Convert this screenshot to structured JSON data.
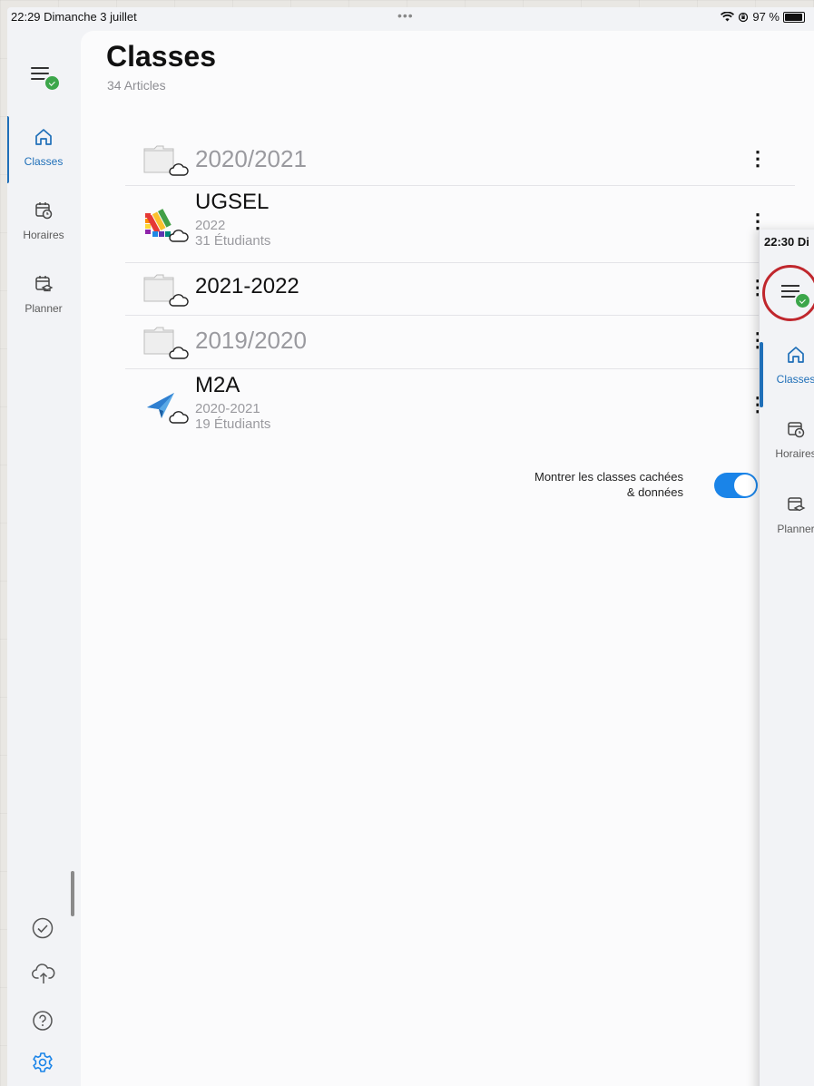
{
  "status": {
    "time_date": "22:29 Dimanche 3 juillet",
    "multitask_dots": "•••",
    "battery": "97 %"
  },
  "sidebar": {
    "items": [
      {
        "label": "Classes",
        "icon": "home-icon",
        "active": true
      },
      {
        "label": "Horaires",
        "icon": "calendar-clock-icon",
        "active": false
      },
      {
        "label": "Planner",
        "icon": "calendar-cap-icon",
        "active": false
      }
    ],
    "bottom_icons": [
      "check-circle-icon",
      "cloud-upload-icon",
      "help-icon",
      "settings-icon"
    ]
  },
  "header": {
    "title": "Classes",
    "subtitle": "34 Articles"
  },
  "list": [
    {
      "type": "folder",
      "title": "2020/2021",
      "muted": true
    },
    {
      "type": "class",
      "title": "UGSEL",
      "year": "2022",
      "students": "31 Étudiants",
      "icon": "color-swatches-icon"
    },
    {
      "type": "folder",
      "title": "2021-2022",
      "muted": false
    },
    {
      "type": "folder",
      "title": "2019/2020",
      "muted": true
    },
    {
      "type": "class",
      "title": "M2A",
      "year": "2020-2021",
      "students": "19 Étudiants",
      "icon": "paper-plane-icon"
    }
  ],
  "toggle": {
    "label_line1": "Montrer les classes cachées",
    "label_line2": "& données",
    "on": true
  },
  "fab": {
    "label": "+"
  },
  "overlay": {
    "time": "22:30 Di",
    "items": [
      {
        "label": "Classes",
        "active": true
      },
      {
        "label": "Horaires",
        "active": false
      },
      {
        "label": "Planner",
        "active": false
      }
    ]
  },
  "colors": {
    "accent": "#1a84e8",
    "nav_active": "#1f6fb8",
    "sync_badge": "#3ca64a",
    "highlight_ring": "#c0272d"
  }
}
